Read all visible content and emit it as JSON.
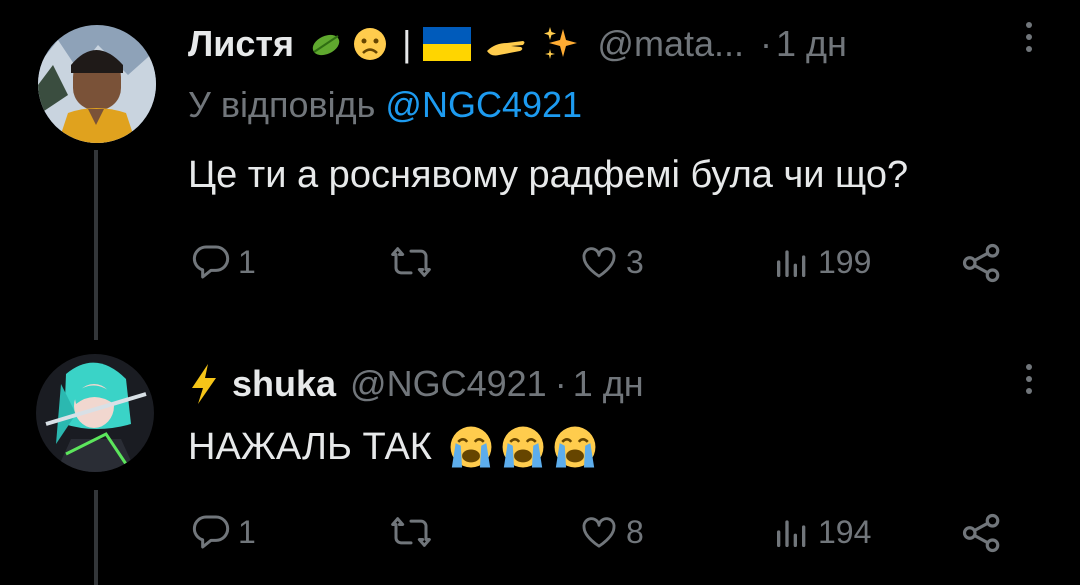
{
  "tweets": [
    {
      "name": "Листя",
      "separator": "|",
      "handle": "@mata...",
      "dot": "·",
      "time": "1 дн",
      "reply_prefix": "У відповідь",
      "reply_to": "@NGC4921",
      "text": "Це ти а роснявому радфемі була чи що?",
      "name_emojis": [
        "leaf-icon",
        "frowning-face-icon",
        "ukraine-flag-icon",
        "hand-icon",
        "sparkles-icon"
      ],
      "stats": {
        "replies": "1",
        "likes": "3",
        "views": "199"
      }
    },
    {
      "name_prefix_icon": "lightning-icon",
      "name": "shuka",
      "handle": "@NGC4921",
      "dot": "·",
      "time": "1 дн",
      "text": "НАЖАЛЬ ТАК",
      "text_emojis": [
        "loudly-crying-face-icon",
        "loudly-crying-face-icon",
        "loudly-crying-face-icon"
      ],
      "stats": {
        "replies": "1",
        "likes": "8",
        "views": "194"
      }
    }
  ],
  "colors": {
    "background": "#000000",
    "text": "#e7e9ea",
    "secondary": "#71767b",
    "accent": "#1d9bf0",
    "lightning": "#f5c518"
  }
}
